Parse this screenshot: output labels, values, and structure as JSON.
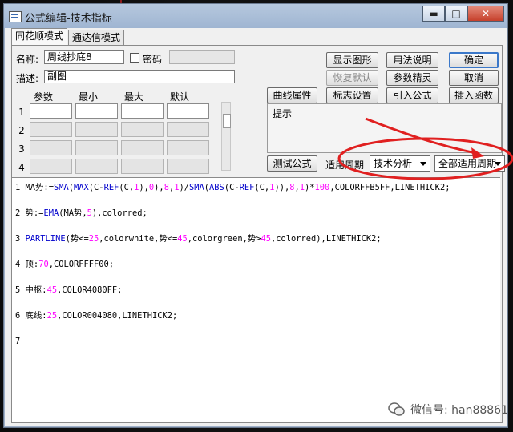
{
  "window": {
    "title": "公式编辑-技术指标",
    "controls": {
      "minimize": "▬",
      "maximize": "□",
      "close": "✕"
    }
  },
  "tabs": [
    {
      "label": "同花顺模式",
      "active": true
    },
    {
      "label": "通达信模式",
      "active": false
    }
  ],
  "form": {
    "name_label": "名称:",
    "name_value": "周线抄底8",
    "password_label": "密码",
    "desc_label": "描述:",
    "desc_value": "副图"
  },
  "params": {
    "headers": [
      "参数",
      "最小",
      "最大",
      "默认"
    ],
    "rows": [
      "1",
      "2",
      "3",
      "4"
    ]
  },
  "buttons": {
    "show_graph": "显示图形",
    "usage": "用法说明",
    "confirm": "确定",
    "restore_default": "恢复默认",
    "param_wizard": "参数精灵",
    "cancel": "取消",
    "line_props": "曲线属性",
    "marker_settings": "标志设置",
    "import_formula": "引入公式",
    "insert_function": "插入函数",
    "test_formula": "测试公式"
  },
  "hint": {
    "label": "提示"
  },
  "period": {
    "label": "适用周期",
    "category_value": "技术分析",
    "period_value": "全部适用周期"
  },
  "code_lines": [
    "1",
    "2",
    "3",
    "4",
    "5",
    "6",
    "7"
  ],
  "code": {
    "l1a": "MA势:=",
    "l1b": "SMA",
    "l1c": "(",
    "l1d": "MAX",
    "l1e": "(C-",
    "l1f": "REF",
    "l1g": "(C,",
    "l1h": "1",
    "l1i": "),",
    "l1j": "0",
    "l1k": "),",
    "l1l": "8",
    "l1m": ",",
    "l1n": "1",
    "l1o": ")/",
    "l1p": "SMA",
    "l1q": "(",
    "l1r": "ABS",
    "l1s": "(C-",
    "l1t": "REF",
    "l1u": "(C,",
    "l1v": "1",
    "l1w": ")),",
    "l1x": "8",
    "l1y": ",",
    "l1z": "1",
    "l1aa": ")*",
    "l1ab": "100",
    "l1ac": ",COLORFFB5FF,LINETHICK2;",
    "l2a": "势:=",
    "l2b": "EMA",
    "l2c": "(MA势,",
    "l2d": "5",
    "l2e": "),colorred;",
    "l3a": "PARTLINE",
    "l3b": "(势<=",
    "l3c": "25",
    "l3d": ",colorwhite,势<=",
    "l3e": "45",
    "l3f": ",colorgreen,势>",
    "l3g": "45",
    "l3h": ",colorred),LINETHICK2;",
    "l4a": "顶:",
    "l4b": "70",
    "l4c": ",COLORFFFF00;",
    "l5a": "中枢:",
    "l5b": "45",
    "l5c": ",COLOR4080FF;",
    "l6a": "底线:",
    "l6b": "25",
    "l6c": ",COLOR004080,LINETHICK2;"
  },
  "watermark": {
    "text": "微信号: han88861"
  },
  "colors": {
    "keyword": "#0000cc",
    "number": "#ff00ff",
    "annotation": "#e02020"
  }
}
